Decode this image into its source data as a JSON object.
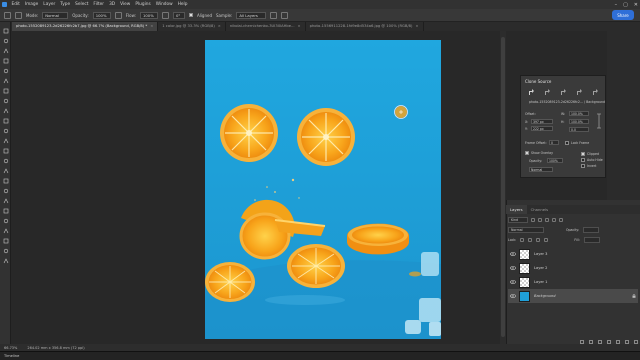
{
  "menu": [
    "Edit",
    "Image",
    "Layer",
    "Type",
    "Select",
    "Filter",
    "3D",
    "View",
    "Plugins",
    "Window",
    "Help"
  ],
  "options_bar": {
    "mode_label": "Mode:",
    "mode_value": "Normal",
    "opacity_label": "Opacity:",
    "opacity_value": "100%",
    "flow_label": "Flow:",
    "flow_value": "100%",
    "angle_value": "0°",
    "aligned_label": "Aligned",
    "sample_label": "Sample:",
    "sample_value": "All Layers",
    "share_label": "Share"
  },
  "tabs": [
    {
      "label": "photo-1552089123-2d26226fc2b7.jpg @ 66.7% (Background, RGB/8) *",
      "active": true
    },
    {
      "label": "1 color.jpg @ 33.3% (RGB/8)",
      "active": false
    },
    {
      "label": "nikolai-chernichenko-3UI3I0AHbe...",
      "active": false
    },
    {
      "label": "photo-1556911228-1fd9e8d534a6.jpg @ 100% (RGB/8)",
      "active": false
    }
  ],
  "clone_source": {
    "title": "Clone Source",
    "source_file": "photo-1552089123-2d26226fc2... / Background",
    "offset_label": "Offset:",
    "x_label": "X:",
    "x_value": "397 px",
    "y_label": "Y:",
    "y_value": "222 px",
    "w_label": "W:",
    "w_value": "100.0%",
    "h_label": "H:",
    "h_value": "100.0%",
    "angle_value": "0.0",
    "frame_offset_label": "Frame Offset:",
    "frame_offset_value": "0",
    "lock_frame_label": "Lock Frame",
    "show_overlay_label": "Show Overlay",
    "opacity_label": "Opacity:",
    "opacity_value": "100%",
    "mode_value": "Normal",
    "clipped_label": "Clipped",
    "auto_hide_label": "Auto Hide",
    "invert_label": "Invert"
  },
  "layers_panel": {
    "tabs": [
      "Layers",
      "Channels"
    ],
    "filter_value": "Kind",
    "blend_mode_value": "Normal",
    "opacity_label": "Opacity:",
    "lock_label": "Lock:",
    "fill_label": "Fill:",
    "layers": [
      {
        "name": "Layer 3",
        "selected": false
      },
      {
        "name": "Layer 2",
        "selected": false
      },
      {
        "name": "Layer 1",
        "selected": false
      },
      {
        "name": "Background",
        "selected": true
      }
    ]
  },
  "status": {
    "zoom": "66.73%",
    "doc_size": "264.02 mm x 356.8 mm (72 ppi)"
  },
  "timeline_label": "Timeline",
  "colors": {
    "canvas_blue": "#1fa3dc",
    "orange": "#f6a11a",
    "share_blue": "#2f6fd8"
  }
}
